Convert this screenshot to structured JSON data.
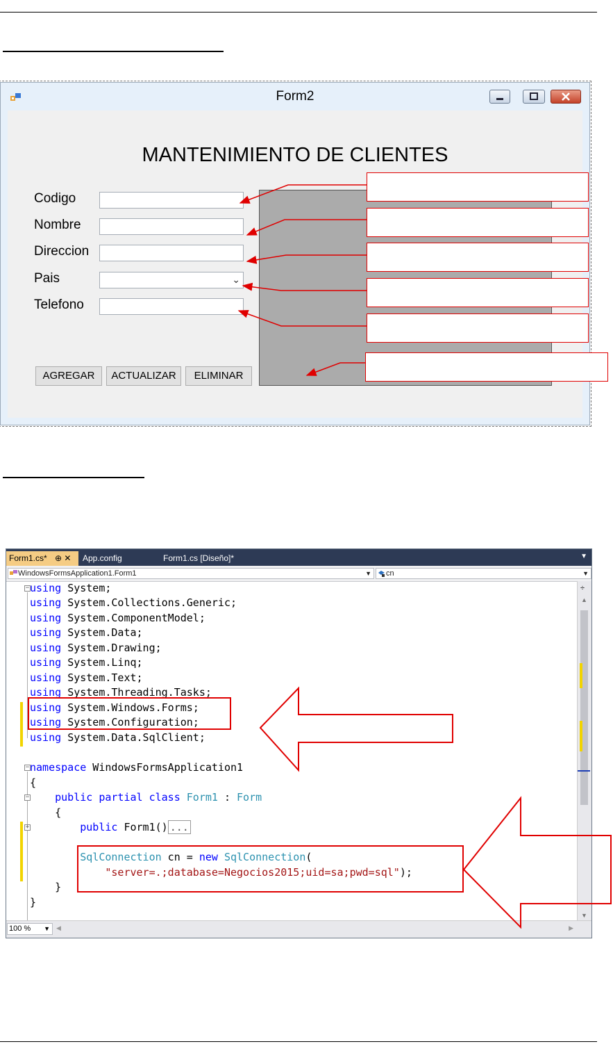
{
  "window": {
    "title": "Form2",
    "form_title": "MANTENIMIENTO DE CLIENTES",
    "labels": [
      "Codigo",
      "Nombre",
      "Direccion",
      "Pais",
      "Telefono"
    ],
    "buttons": {
      "add": "AGREGAR",
      "update": "ACTUALIZAR",
      "delete": "ELIMINAR"
    }
  },
  "editor": {
    "tabs": [
      "Form1.cs*",
      "App.config",
      "Form1.cs [Diseño]*"
    ],
    "tab_pin": "⊕ ✕",
    "nav_class": "WindowsFormsApplication1.Form1",
    "nav_member": "cn",
    "zoom": "100 %",
    "code": {
      "l1": "System;",
      "l2": "System.Collections.Generic;",
      "l3": "System.ComponentModel;",
      "l4": "System.Data;",
      "l5": "System.Drawing;",
      "l6": "System.Linq;",
      "l7": "System.Text;",
      "l8": "System.Threading.Tasks;",
      "l9": "System.Windows.Forms;",
      "l10": "System.Configuration;",
      "l11": "System.Data.SqlClient;",
      "using": "using",
      "namespace_kw": "namespace",
      "namespace_name": " WindowsFormsApplication1",
      "open_brace": "{",
      "close_brace": "}",
      "class_decl_kw": "public partial class",
      "class_name": "Form1",
      "colon": " : ",
      "base": "Form",
      "ctor_kw": "public",
      "ctor_name": " Form1()",
      "ctor_collapsed": "...",
      "field_type": "SqlConnection",
      "field_mid": " cn = ",
      "new_kw": "new",
      "ctor_type": "SqlConnection",
      "paren_open": "(",
      "conn_string": "\"server=.;database=Negocios2015;uid=sa;pwd=sql\"",
      "paren_close": ");"
    }
  }
}
